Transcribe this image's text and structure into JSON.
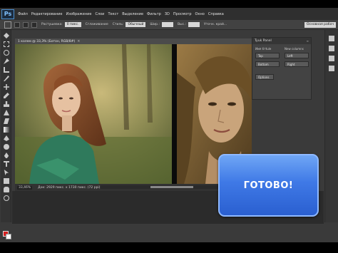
{
  "app": {
    "logo": "Ps"
  },
  "menu": [
    "Файл",
    "Редактирование",
    "Изображение",
    "Слои",
    "Текст",
    "Выделение",
    "Фильтр",
    "3D",
    "Просмотр",
    "Окно",
    "Справка"
  ],
  "options": {
    "feather_label": "Растушевка:",
    "feather_value": "0 пикс.",
    "antialias_label": "Сглаживание",
    "style_label": "Стиль:",
    "style_value": "Обычный",
    "width_label": "Шир.:",
    "height_label": "Выс.:",
    "refine_button": "Уточн. край...",
    "workspace": "Основная рабоч"
  },
  "document": {
    "tab_title": "1 колем @ 33,3% (Ботон, RGB/8#)",
    "close_glyph": "×",
    "zoom": "33,46%",
    "doc_info": "Док: 2929 пикс. x 1730 пикс. (72 ppi)",
    "arrow_glyph": "▶"
  },
  "panel": {
    "title": "Tyuk Panel",
    "menu_glyph": "≡",
    "left_header": "Имя tiтtule",
    "right_header": "New columns",
    "left_buttons": [
      "Top",
      "Bottom"
    ],
    "right_buttons": [
      "Left",
      "Right"
    ],
    "options_button": "Options"
  },
  "overlay": {
    "label": "ГОТОВО!"
  },
  "colors": {
    "foreground": "#d41f1f",
    "background": "#ffffff",
    "overlay_blue": "#3f79e6"
  }
}
